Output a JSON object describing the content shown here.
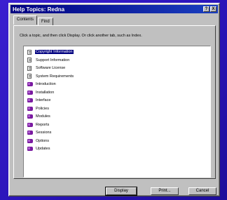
{
  "window": {
    "title": "Help Topics: Redna",
    "help_button": "?",
    "close_button": "X"
  },
  "tabs": [
    {
      "label": "Contents",
      "active": true
    },
    {
      "label": "Find",
      "active": false
    }
  ],
  "instructions": "Click a topic, and then click Display. Or click another tab, such as Index.",
  "tree": {
    "items": [
      {
        "label": "Copyright Information",
        "icon": "page-icon",
        "selected": true
      },
      {
        "label": "Support Information",
        "icon": "page-icon",
        "selected": false
      },
      {
        "label": "Software License",
        "icon": "page-icon",
        "selected": false
      },
      {
        "label": "System Requirements",
        "icon": "page-icon",
        "selected": false
      },
      {
        "label": "Introduction",
        "icon": "book-icon",
        "selected": false
      },
      {
        "label": "Installation",
        "icon": "book-icon",
        "selected": false
      },
      {
        "label": "Interface",
        "icon": "book-icon",
        "selected": false
      },
      {
        "label": "Policies",
        "icon": "book-icon",
        "selected": false
      },
      {
        "label": "Modules",
        "icon": "book-icon",
        "selected": false
      },
      {
        "label": "Reports",
        "icon": "book-icon",
        "selected": false
      },
      {
        "label": "Sessions",
        "icon": "book-icon",
        "selected": false
      },
      {
        "label": "Options",
        "icon": "book-icon",
        "selected": false
      },
      {
        "label": "Updates",
        "icon": "book-icon",
        "selected": false
      }
    ]
  },
  "buttons": {
    "display": "Display",
    "print": "Print...",
    "cancel": "Cancel"
  },
  "colors": {
    "desktop": "#2a14b8",
    "titlebar": "#000080",
    "selection": "#000080",
    "book": "#7a1aa0"
  }
}
